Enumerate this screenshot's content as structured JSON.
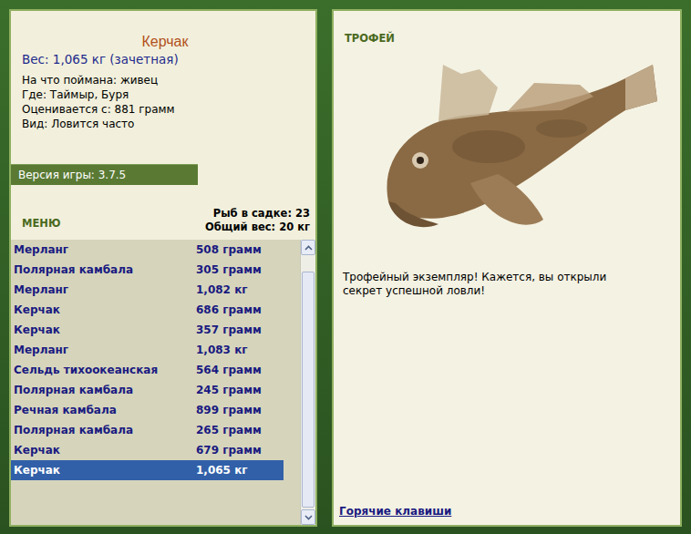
{
  "catch": {
    "title": "Керчак",
    "weight": "Вес: 1,065 кг (зачетная)",
    "details": [
      "На что поймана: живец",
      "Где: Таймыр, Буря",
      "Оценивается с: 881 грамм",
      "Вид: Ловится часто"
    ]
  },
  "version": "Версия игры: 3.7.5",
  "menu": "МЕНЮ",
  "summary": [
    "Рыб в садке: 23",
    "Общий вес: 20 кг"
  ],
  "fish_list": [
    {
      "name": "Мерланг",
      "weight": "508 грамм",
      "selected": false
    },
    {
      "name": "Полярная камбала",
      "weight": "305 грамм",
      "selected": false
    },
    {
      "name": "Мерланг",
      "weight": "1,082 кг",
      "selected": false
    },
    {
      "name": "Керчак",
      "weight": "686 грамм",
      "selected": false
    },
    {
      "name": "Керчак",
      "weight": "357 грамм",
      "selected": false
    },
    {
      "name": "Мерланг",
      "weight": "1,083 кг",
      "selected": false
    },
    {
      "name": "Сельдь тихоокеанская",
      "weight": "564 грамм",
      "selected": false
    },
    {
      "name": "Полярная камбала",
      "weight": "245 грамм",
      "selected": false
    },
    {
      "name": "Речная камбала",
      "weight": "899 грамм",
      "selected": false
    },
    {
      "name": "Полярная камбала",
      "weight": "265 грамм",
      "selected": false
    },
    {
      "name": "Керчак",
      "weight": "679 грамм",
      "selected": false
    },
    {
      "name": "Керчак",
      "weight": "1,065 кг",
      "selected": true
    }
  ],
  "list_scroll": {
    "level": 0.93
  },
  "trophy": {
    "heading": "ТРОФЕЙ",
    "message": "Трофейный экземпляр! Кажется, вы открыли секрет успешной ловли!"
  },
  "hotkeys": "Горячие клавиши"
}
